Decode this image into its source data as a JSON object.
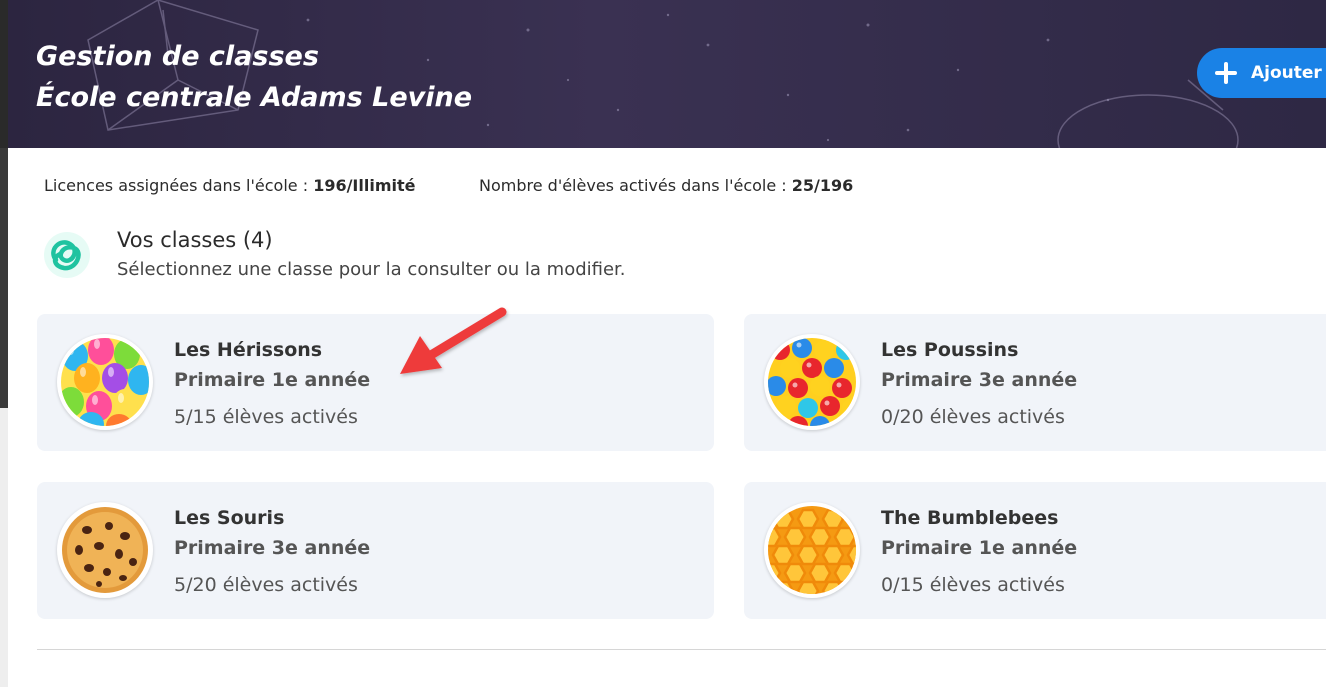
{
  "header": {
    "title_line1": "Gestion de classes",
    "title_line2": "École centrale Adams Levine",
    "add_button_label": "Ajouter",
    "add_button_icon": "plus-icon",
    "background_color": "#2e2844",
    "button_color": "#1a82e6"
  },
  "stats": {
    "licenses_label": "Licences assignées dans l'école : ",
    "licenses_value": "196/Illimité",
    "students_label": "Nombre d'élèves activés dans l'école : ",
    "students_value": "25/196"
  },
  "classes_section": {
    "icon": "classes-knot-icon",
    "title": "Vos classes (4)",
    "subtitle": "Sélectionnez une classe pour la consulter ou la modifier."
  },
  "classes": [
    {
      "name": "Les Hérissons",
      "grade": "Primaire 1e année",
      "students": "5/15 élèves activés",
      "avatar": "balloons-avatar"
    },
    {
      "name": "Les Poussins",
      "grade": "Primaire 3e année",
      "students": "0/20 élèves activés",
      "avatar": "gumballs-avatar"
    },
    {
      "name": "Les Souris",
      "grade": "Primaire 3e année",
      "students": "5/20 élèves activés",
      "avatar": "cookie-avatar"
    },
    {
      "name": "The Bumblebees",
      "grade": "Primaire 1e année",
      "students": "0/15 élèves activés",
      "avatar": "honeycomb-avatar"
    }
  ],
  "annotation": {
    "icon": "red-arrow-icon",
    "color": "#ee3b3b"
  }
}
